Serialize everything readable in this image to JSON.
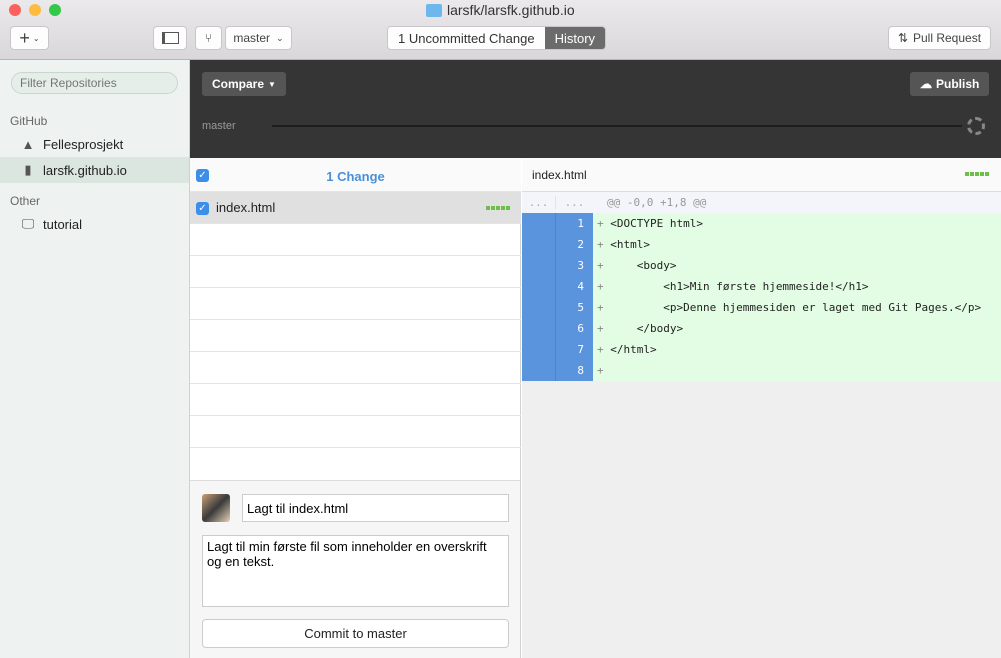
{
  "window": {
    "title": "larsfk/larsfk.github.io"
  },
  "toolbar": {
    "add_label": "+",
    "branch": "master",
    "tab_uncommitted": "1 Uncommitted Change",
    "tab_history": "History",
    "pull_request": "Pull Request"
  },
  "sidebar": {
    "filter_placeholder": "Filter Repositories",
    "sections": [
      {
        "title": "GitHub",
        "items": [
          {
            "label": "Fellesprosjekt",
            "icon": "warning-icon"
          },
          {
            "label": "larsfk.github.io",
            "icon": "repo-icon",
            "selected": true
          }
        ]
      },
      {
        "title": "Other",
        "items": [
          {
            "label": "tutorial",
            "icon": "computer-icon"
          }
        ]
      }
    ]
  },
  "header": {
    "compare": "Compare",
    "publish": "Publish",
    "branch": "master"
  },
  "changes": {
    "title": "1 Change",
    "files": [
      {
        "name": "index.html",
        "checked": true
      }
    ]
  },
  "commit": {
    "summary": "Lagt til index.html",
    "description": "Lagt til min første fil som inneholder en overskrift og en tekst.",
    "button": "Commit to master"
  },
  "diff": {
    "file": "index.html",
    "hunk": "@@ -0,0 +1,8 @@",
    "old_gutter": "...",
    "new_gutter": "...",
    "lines": [
      {
        "n": "1",
        "text": "<DOCTYPE html>"
      },
      {
        "n": "2",
        "text": "<html>"
      },
      {
        "n": "3",
        "text": "    <body>"
      },
      {
        "n": "4",
        "text": "        <h1>Min første hjemmeside!</h1>"
      },
      {
        "n": "5",
        "text": "        <p>Denne hjemmesiden er laget med Git Pages.</p>"
      },
      {
        "n": "6",
        "text": "    </body>"
      },
      {
        "n": "7",
        "text": "</html>"
      },
      {
        "n": "8",
        "text": ""
      }
    ]
  },
  "colors": {
    "accent": "#3b8eea",
    "added_bg": "#e2fde3",
    "gutter": "#5a94dd",
    "dark_header": "#353535"
  }
}
